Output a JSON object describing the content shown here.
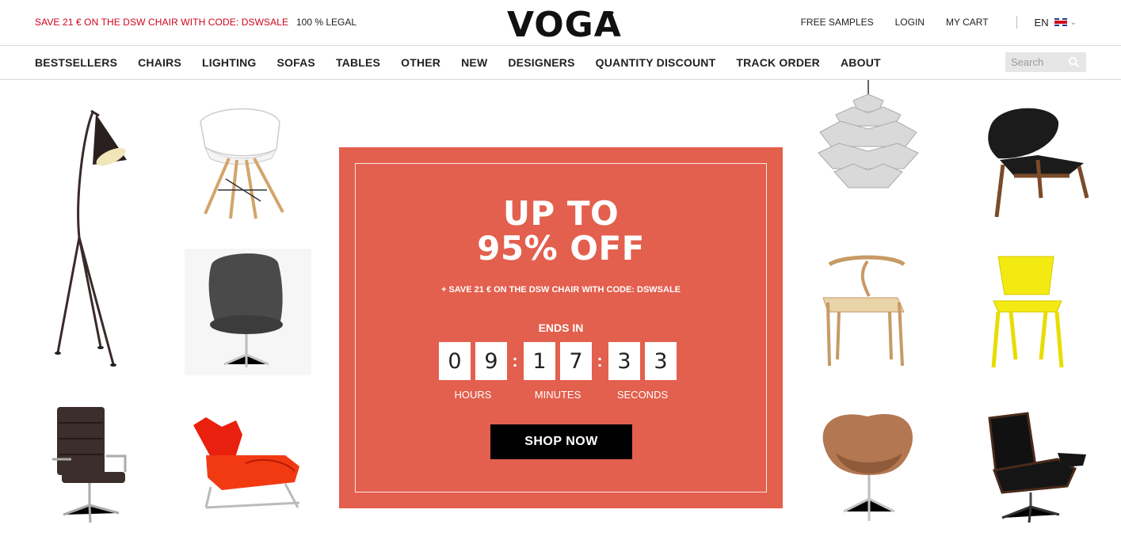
{
  "topbar": {
    "promo_text": "SAVE 21 € ON THE DSW CHAIR WITH CODE: DSWSALE",
    "legal_text": "100 % LEGAL",
    "logo": "VOGA",
    "links": [
      "FREE SAMPLES",
      "LOGIN",
      "MY CART"
    ],
    "language": "EN"
  },
  "nav": {
    "items": [
      "BESTSELLERS",
      "CHAIRS",
      "LIGHTING",
      "SOFAS",
      "TABLES",
      "OTHER",
      "NEW",
      "DESIGNERS",
      "QUANTITY DISCOUNT",
      "TRACK ORDER",
      "ABOUT"
    ],
    "search_placeholder": "Search"
  },
  "promo": {
    "headline_line1": "UP TO",
    "headline_line2": "95% OFF",
    "subtext": "+ SAVE 21 € ON THE DSW CHAIR WITH CODE: DSWSALE",
    "ends_label": "ENDS IN",
    "countdown": {
      "hours": [
        "0",
        "9"
      ],
      "minutes": [
        "1",
        "7"
      ],
      "seconds": [
        "3",
        "3"
      ]
    },
    "labels": {
      "hours": "HOURS",
      "minutes": "MINUTES",
      "seconds": "SECONDS"
    },
    "cta": "SHOP NOW"
  },
  "products": [
    "floor-lamp-icon",
    "eames-armchair-icon",
    "egg-chair-icon",
    "office-chair-icon",
    "ox-chair-icon",
    "artichoke-lamp-icon",
    "shell-chair-icon",
    "wishbone-chair-icon",
    "tolix-chair-icon",
    "swan-chair-icon",
    "lounge-chair-icon"
  ],
  "colors": {
    "accent_red": "#d0021b",
    "promo_bg": "#e35f4e",
    "cta_bg": "#000000"
  }
}
